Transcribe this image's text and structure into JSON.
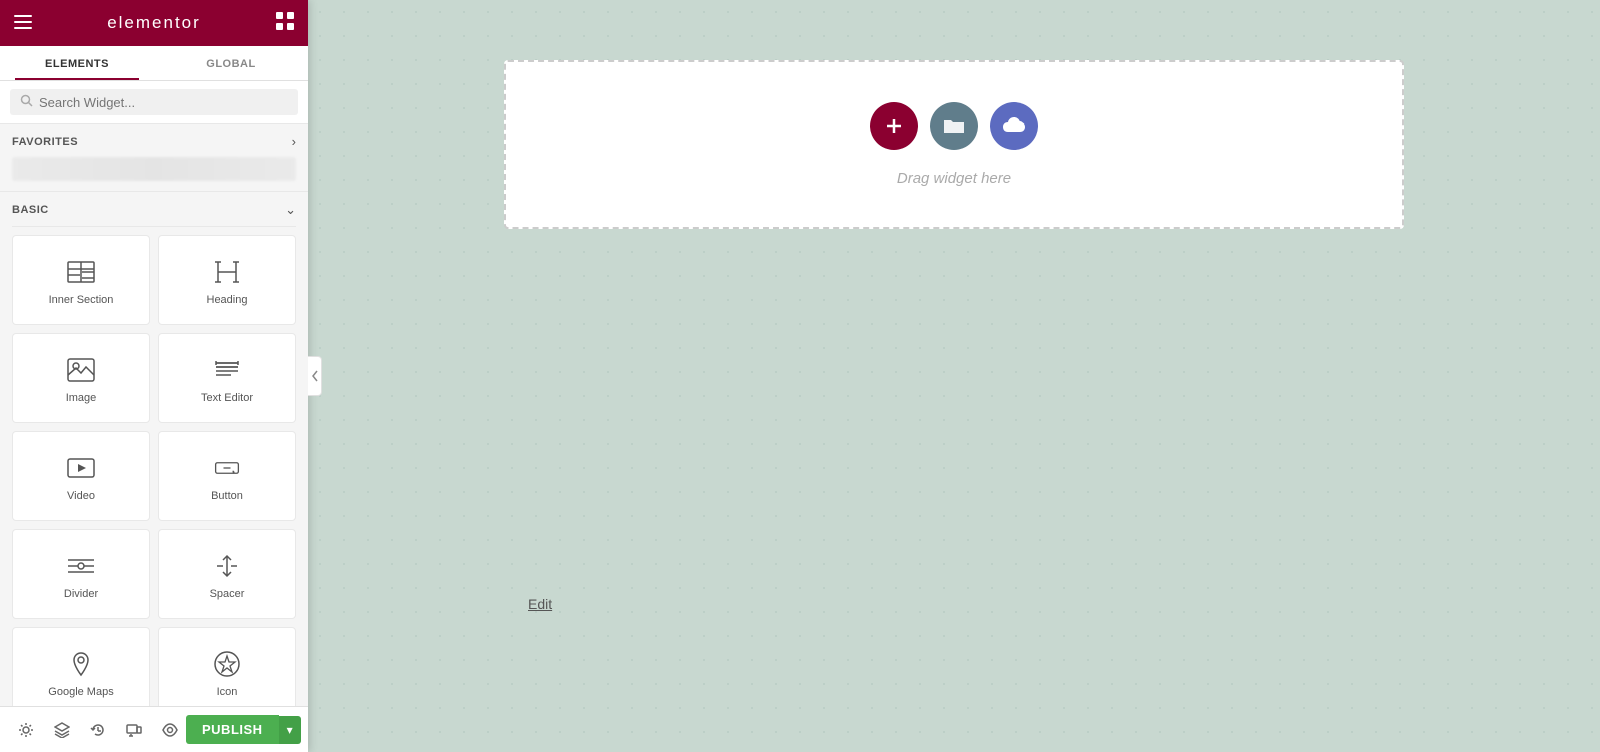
{
  "header": {
    "logo": "elementor",
    "hamburger_unicode": "☰",
    "grid_unicode": "⊞"
  },
  "tabs": [
    {
      "id": "elements",
      "label": "ELEMENTS",
      "active": true
    },
    {
      "id": "global",
      "label": "GLOBAL",
      "active": false
    }
  ],
  "search": {
    "placeholder": "Search Widget..."
  },
  "favorites": {
    "label": "FAVORITES",
    "chevron": "›"
  },
  "basic": {
    "label": "BASIC",
    "chevron": "⌄"
  },
  "widgets": [
    {
      "id": "inner-section",
      "label": "Inner Section",
      "icon_type": "inner-section"
    },
    {
      "id": "heading",
      "label": "Heading",
      "icon_type": "heading"
    },
    {
      "id": "image",
      "label": "Image",
      "icon_type": "image"
    },
    {
      "id": "text-editor",
      "label": "Text Editor",
      "icon_type": "text-editor"
    },
    {
      "id": "video",
      "label": "Video",
      "icon_type": "video"
    },
    {
      "id": "button",
      "label": "Button",
      "icon_type": "button"
    },
    {
      "id": "divider",
      "label": "Divider",
      "icon_type": "divider"
    },
    {
      "id": "spacer",
      "label": "Spacer",
      "icon_type": "spacer"
    },
    {
      "id": "google-maps",
      "label": "Google Maps",
      "icon_type": "google-maps"
    },
    {
      "id": "icon",
      "label": "Icon",
      "icon_type": "icon"
    }
  ],
  "canvas": {
    "drag_hint": "Drag widget here",
    "edit_link": "Edit"
  },
  "action_buttons": {
    "add_label": "+",
    "folder_label": "🗀",
    "cloud_label": "☁"
  },
  "toolbar": {
    "publish_label": "PUBLISH",
    "settings_unicode": "⚙",
    "layers_unicode": "⧉",
    "history_unicode": "↺",
    "responsive_unicode": "⊡",
    "view_unicode": "👁"
  },
  "colors": {
    "brand": "#8b0030",
    "green": "#4caf50",
    "canvas_bg": "#c8d8d0"
  }
}
